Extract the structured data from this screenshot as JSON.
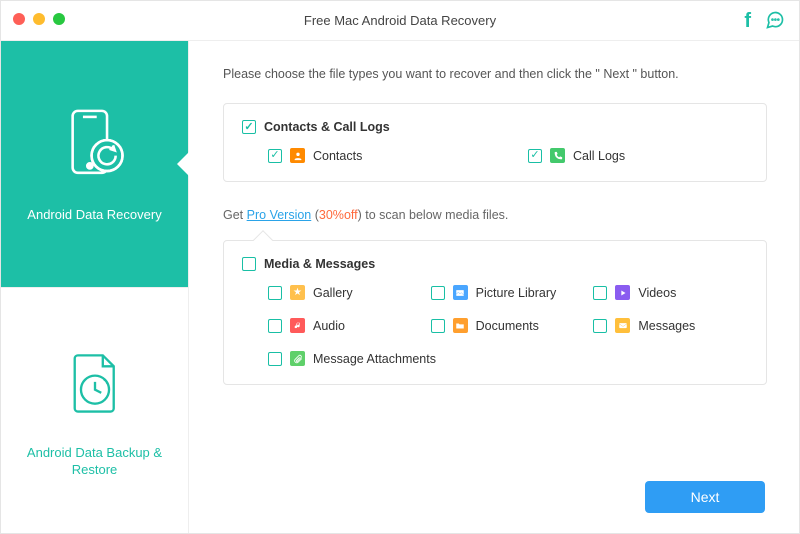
{
  "window": {
    "title": "Free Mac Android Data Recovery"
  },
  "titlebar_icons": {
    "facebook": "facebook-icon",
    "feedback": "chat-icon"
  },
  "sidebar": {
    "items": [
      {
        "label": "Android Data Recovery",
        "icon": "phone-recover-icon",
        "active": true
      },
      {
        "label": "Android Data Backup & Restore",
        "icon": "file-clock-icon",
        "active": false
      }
    ]
  },
  "main": {
    "instruction": "Please choose the file types you want to recover and then click the \" Next \" button.",
    "group_contacts": {
      "title": "Contacts & Call Logs",
      "checked": true,
      "items": [
        {
          "key": "contacts",
          "label": "Contacts",
          "checked": true,
          "icon_bg": "#ff8a00"
        },
        {
          "key": "call_logs",
          "label": "Call Logs",
          "checked": true,
          "icon_bg": "#43c96c"
        }
      ]
    },
    "promo": {
      "prefix": "Get",
      "link": "Pro Version",
      "discount": "30%",
      "off_label": "off",
      "suffix": ") to scan below media files."
    },
    "group_media": {
      "title": "Media & Messages",
      "checked": false,
      "items": [
        {
          "key": "gallery",
          "label": "Gallery",
          "icon_bg": "#ffc04d"
        },
        {
          "key": "piclib",
          "label": "Picture Library",
          "icon_bg": "#4aa6ff"
        },
        {
          "key": "videos",
          "label": "Videos",
          "icon_bg": "#8a5cf0"
        },
        {
          "key": "audio",
          "label": "Audio",
          "icon_bg": "#ff5a5a"
        },
        {
          "key": "documents",
          "label": "Documents",
          "icon_bg": "#ff9f2e"
        },
        {
          "key": "messages",
          "label": "Messages",
          "icon_bg": "#ffbf3b"
        },
        {
          "key": "attach",
          "label": "Message Attachments",
          "icon_bg": "#5fd06a"
        }
      ]
    },
    "next_label": "Next"
  },
  "colors": {
    "accent_teal": "#1dbfa6",
    "accent_blue": "#2f9df4",
    "promo_orange": "#ff6a3d",
    "link_blue": "#2aa3e8"
  }
}
